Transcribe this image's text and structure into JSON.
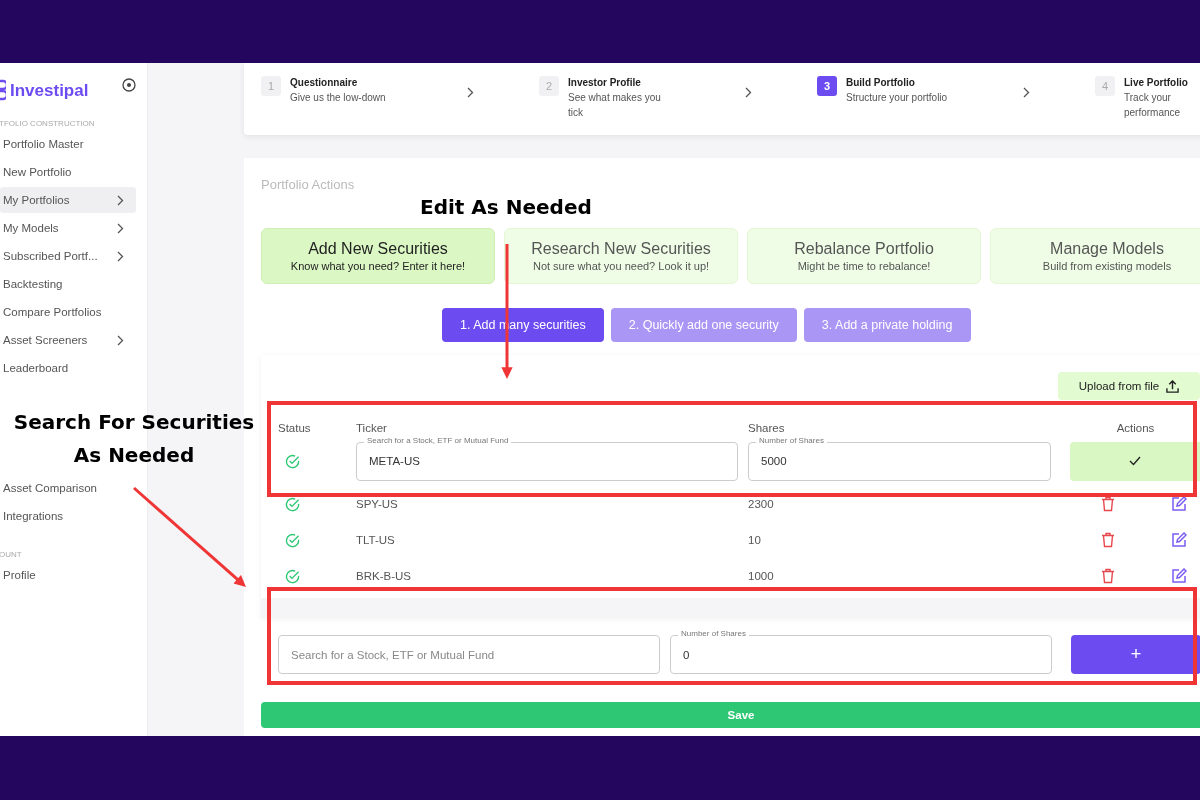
{
  "sidebar": {
    "brand": "Investipal",
    "sections": [
      {
        "heading": "TFOLIO CONSTRUCTION",
        "items": [
          {
            "label": "Portfolio Master",
            "selected": false,
            "has_submenu": false
          },
          {
            "label": "New Portfolio",
            "selected": false,
            "has_submenu": false
          },
          {
            "label": "My Portfolios",
            "selected": true,
            "has_submenu": true
          },
          {
            "label": "My Models",
            "selected": false,
            "has_submenu": true
          },
          {
            "label": "Subscribed Portf...",
            "selected": false,
            "has_submenu": true
          },
          {
            "label": "Backtesting",
            "selected": false,
            "has_submenu": false
          },
          {
            "label": "Compare Portfolios",
            "selected": false,
            "has_submenu": false
          },
          {
            "label": "Asset Screeners",
            "selected": false,
            "has_submenu": true
          },
          {
            "label": "Leaderboard",
            "selected": false,
            "has_submenu": false
          }
        ]
      },
      {
        "items": [
          {
            "label": "Asset Comparison",
            "selected": false,
            "has_submenu": false
          },
          {
            "label": "Integrations",
            "selected": false,
            "has_submenu": false
          }
        ]
      },
      {
        "heading": "OUNT",
        "items": [
          {
            "label": "Profile",
            "selected": false,
            "has_submenu": false
          }
        ]
      }
    ]
  },
  "stepper": [
    {
      "number": "1",
      "title": "Questionnaire",
      "subtitle": "Give us the low-down",
      "selected": false
    },
    {
      "number": "2",
      "title": "Investor Profile",
      "subtitle": "See what makes you tick",
      "selected": false
    },
    {
      "number": "3",
      "title": "Build Portfolio",
      "subtitle": "Structure your portfolio",
      "selected": true
    },
    {
      "number": "4",
      "title": "Live Portfolio",
      "subtitle": "Track your performance",
      "selected": false
    }
  ],
  "actions": {
    "title": "Portfolio Actions",
    "cards": [
      {
        "title": "Add New Securities",
        "subtitle": "Know what you need? Enter it here!",
        "selected": true
      },
      {
        "title": "Research New Securities",
        "subtitle": "Not sure what you need? Look it up!",
        "selected": false
      },
      {
        "title": "Rebalance Portfolio",
        "subtitle": "Might be time to rebalance!",
        "selected": false
      },
      {
        "title": "Manage Models",
        "subtitle": "Build from existing models",
        "selected": false
      }
    ],
    "modes": [
      {
        "label": "1. Add many securities",
        "selected": true
      },
      {
        "label": "2. Quickly add one security",
        "selected": false
      },
      {
        "label": "3. Add a private holding",
        "selected": false
      }
    ],
    "upload_button": "Upload from file",
    "table": {
      "columns": [
        "Status",
        "Ticker",
        "Shares",
        "Actions"
      ],
      "editing_row": {
        "ticker_label": "Search for a Stock, ETF or Mutual Fund",
        "ticker": "META-US",
        "shares_label": "Number of Shares",
        "shares": "5000"
      },
      "rows": [
        {
          "ticker": "SPY-US",
          "shares": "2300"
        },
        {
          "ticker": "TLT-US",
          "shares": "10"
        },
        {
          "ticker": "BRK-B-US",
          "shares": "1000"
        }
      ]
    },
    "add_row": {
      "ticker_placeholder": "Search for a Stock, ETF or Mutual Fund",
      "shares_label": "Number of Shares",
      "shares": "0",
      "add_button": "+"
    },
    "save_button": "Save"
  },
  "annotations": [
    {
      "text": "Edit As Needed"
    },
    {
      "text": "Search For Securities\nAs Needed"
    }
  ]
}
